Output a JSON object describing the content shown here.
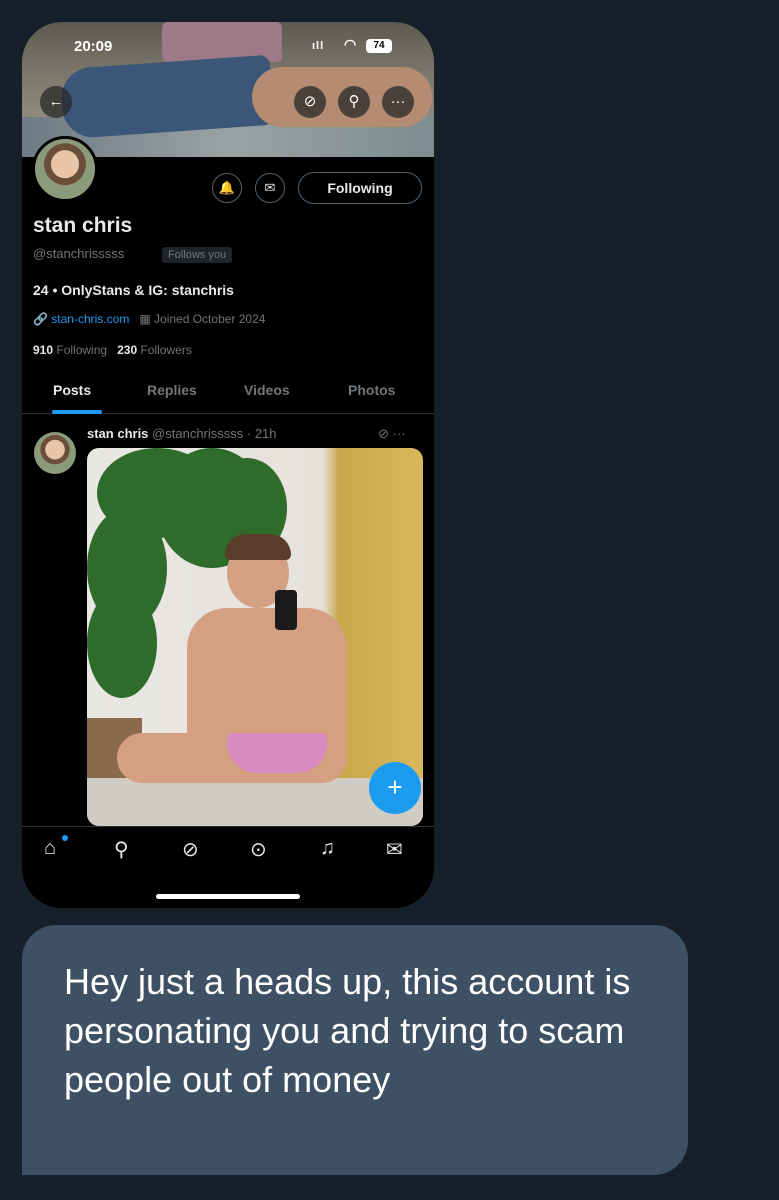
{
  "status_bar": {
    "time": "20:09",
    "signal": "ıll",
    "battery": "74"
  },
  "profile": {
    "name": "stan chris",
    "handle": "@stanchrisssss",
    "follows_you": "Follows you",
    "bio": "24 • OnlyStans & IG: stanchris",
    "link": "stan-chris.com",
    "joined": "Joined October 2024",
    "following_count": "910",
    "following_label": "Following",
    "followers_count": "230",
    "followers_label": "Followers",
    "following_button": "Following"
  },
  "tabs": [
    "Posts",
    "Replies",
    "Videos",
    "Photos"
  ],
  "post": {
    "author": "stan chris",
    "handle_time": "@stanchrisssss · 21h",
    "more": "···"
  },
  "fab_label": "+",
  "message": {
    "text": "Hey just a heads up, this account is personating  you and trying to scam people out of money"
  },
  "colors": {
    "background": "#15202b",
    "bubble": "#3e5164",
    "accent": "#1d9bf0"
  },
  "icons": {
    "back": "back-arrow-icon",
    "grok": "grok-icon",
    "search": "search-icon",
    "more": "more-icon",
    "bell": "bell-plus-icon",
    "mail": "mail-icon",
    "home": "home-icon",
    "nav_search": "search-icon",
    "nav_grok": "grok-icon",
    "play": "play-icon",
    "notifications": "bell-icon",
    "messages": "envelope-icon"
  }
}
